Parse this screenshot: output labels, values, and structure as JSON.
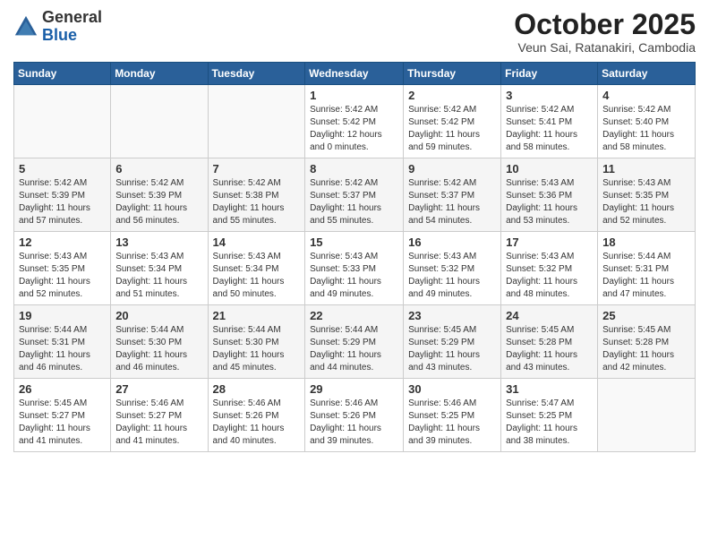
{
  "header": {
    "logo_general": "General",
    "logo_blue": "Blue",
    "month_title": "October 2025",
    "subtitle": "Veun Sai, Ratanakiri, Cambodia"
  },
  "weekdays": [
    "Sunday",
    "Monday",
    "Tuesday",
    "Wednesday",
    "Thursday",
    "Friday",
    "Saturday"
  ],
  "weeks": [
    [
      {
        "day": "",
        "info": ""
      },
      {
        "day": "",
        "info": ""
      },
      {
        "day": "",
        "info": ""
      },
      {
        "day": "1",
        "info": "Sunrise: 5:42 AM\nSunset: 5:42 PM\nDaylight: 12 hours\nand 0 minutes."
      },
      {
        "day": "2",
        "info": "Sunrise: 5:42 AM\nSunset: 5:42 PM\nDaylight: 11 hours\nand 59 minutes."
      },
      {
        "day": "3",
        "info": "Sunrise: 5:42 AM\nSunset: 5:41 PM\nDaylight: 11 hours\nand 58 minutes."
      },
      {
        "day": "4",
        "info": "Sunrise: 5:42 AM\nSunset: 5:40 PM\nDaylight: 11 hours\nand 58 minutes."
      }
    ],
    [
      {
        "day": "5",
        "info": "Sunrise: 5:42 AM\nSunset: 5:39 PM\nDaylight: 11 hours\nand 57 minutes."
      },
      {
        "day": "6",
        "info": "Sunrise: 5:42 AM\nSunset: 5:39 PM\nDaylight: 11 hours\nand 56 minutes."
      },
      {
        "day": "7",
        "info": "Sunrise: 5:42 AM\nSunset: 5:38 PM\nDaylight: 11 hours\nand 55 minutes."
      },
      {
        "day": "8",
        "info": "Sunrise: 5:42 AM\nSunset: 5:37 PM\nDaylight: 11 hours\nand 55 minutes."
      },
      {
        "day": "9",
        "info": "Sunrise: 5:42 AM\nSunset: 5:37 PM\nDaylight: 11 hours\nand 54 minutes."
      },
      {
        "day": "10",
        "info": "Sunrise: 5:43 AM\nSunset: 5:36 PM\nDaylight: 11 hours\nand 53 minutes."
      },
      {
        "day": "11",
        "info": "Sunrise: 5:43 AM\nSunset: 5:35 PM\nDaylight: 11 hours\nand 52 minutes."
      }
    ],
    [
      {
        "day": "12",
        "info": "Sunrise: 5:43 AM\nSunset: 5:35 PM\nDaylight: 11 hours\nand 52 minutes."
      },
      {
        "day": "13",
        "info": "Sunrise: 5:43 AM\nSunset: 5:34 PM\nDaylight: 11 hours\nand 51 minutes."
      },
      {
        "day": "14",
        "info": "Sunrise: 5:43 AM\nSunset: 5:34 PM\nDaylight: 11 hours\nand 50 minutes."
      },
      {
        "day": "15",
        "info": "Sunrise: 5:43 AM\nSunset: 5:33 PM\nDaylight: 11 hours\nand 49 minutes."
      },
      {
        "day": "16",
        "info": "Sunrise: 5:43 AM\nSunset: 5:32 PM\nDaylight: 11 hours\nand 49 minutes."
      },
      {
        "day": "17",
        "info": "Sunrise: 5:43 AM\nSunset: 5:32 PM\nDaylight: 11 hours\nand 48 minutes."
      },
      {
        "day": "18",
        "info": "Sunrise: 5:44 AM\nSunset: 5:31 PM\nDaylight: 11 hours\nand 47 minutes."
      }
    ],
    [
      {
        "day": "19",
        "info": "Sunrise: 5:44 AM\nSunset: 5:31 PM\nDaylight: 11 hours\nand 46 minutes."
      },
      {
        "day": "20",
        "info": "Sunrise: 5:44 AM\nSunset: 5:30 PM\nDaylight: 11 hours\nand 46 minutes."
      },
      {
        "day": "21",
        "info": "Sunrise: 5:44 AM\nSunset: 5:30 PM\nDaylight: 11 hours\nand 45 minutes."
      },
      {
        "day": "22",
        "info": "Sunrise: 5:44 AM\nSunset: 5:29 PM\nDaylight: 11 hours\nand 44 minutes."
      },
      {
        "day": "23",
        "info": "Sunrise: 5:45 AM\nSunset: 5:29 PM\nDaylight: 11 hours\nand 43 minutes."
      },
      {
        "day": "24",
        "info": "Sunrise: 5:45 AM\nSunset: 5:28 PM\nDaylight: 11 hours\nand 43 minutes."
      },
      {
        "day": "25",
        "info": "Sunrise: 5:45 AM\nSunset: 5:28 PM\nDaylight: 11 hours\nand 42 minutes."
      }
    ],
    [
      {
        "day": "26",
        "info": "Sunrise: 5:45 AM\nSunset: 5:27 PM\nDaylight: 11 hours\nand 41 minutes."
      },
      {
        "day": "27",
        "info": "Sunrise: 5:46 AM\nSunset: 5:27 PM\nDaylight: 11 hours\nand 41 minutes."
      },
      {
        "day": "28",
        "info": "Sunrise: 5:46 AM\nSunset: 5:26 PM\nDaylight: 11 hours\nand 40 minutes."
      },
      {
        "day": "29",
        "info": "Sunrise: 5:46 AM\nSunset: 5:26 PM\nDaylight: 11 hours\nand 39 minutes."
      },
      {
        "day": "30",
        "info": "Sunrise: 5:46 AM\nSunset: 5:25 PM\nDaylight: 11 hours\nand 39 minutes."
      },
      {
        "day": "31",
        "info": "Sunrise: 5:47 AM\nSunset: 5:25 PM\nDaylight: 11 hours\nand 38 minutes."
      },
      {
        "day": "",
        "info": ""
      }
    ]
  ]
}
